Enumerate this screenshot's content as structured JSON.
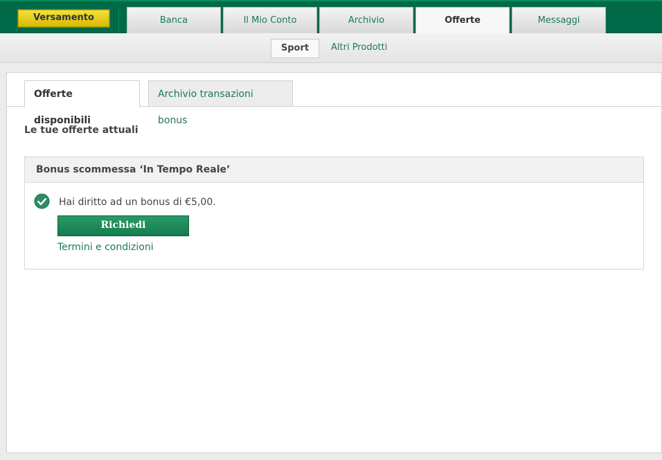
{
  "topbar": {
    "deposit_label": "Versamento",
    "tabs": [
      {
        "label": "Banca"
      },
      {
        "label": "Il Mio Conto"
      },
      {
        "label": "Archivio"
      },
      {
        "label": "Offerte"
      },
      {
        "label": "Messaggi"
      }
    ],
    "active_tab": "Offerte"
  },
  "subnav": {
    "items": [
      {
        "label": "Sport"
      },
      {
        "label": "Altri Prodotti"
      }
    ],
    "active": "Sport"
  },
  "content": {
    "tabs": [
      {
        "label": "Offerte disponibili"
      },
      {
        "label": "Archivio transazioni bonus"
      }
    ],
    "section_title": "Le tue offerte attuali",
    "offer": {
      "title": "Bonus scommessa ‘In Tempo Reale’",
      "message": "Hai diritto ad un bonus di €5,00.",
      "claim_label": "Richiedi",
      "terms_label": "Termini e condizioni",
      "status_icon": "check-circle-icon"
    }
  },
  "colors": {
    "brand_green": "#006a48",
    "link_green": "#1a7a55",
    "deposit_yellow": "#e8cf1a",
    "button_green": "#1e8a5a"
  }
}
